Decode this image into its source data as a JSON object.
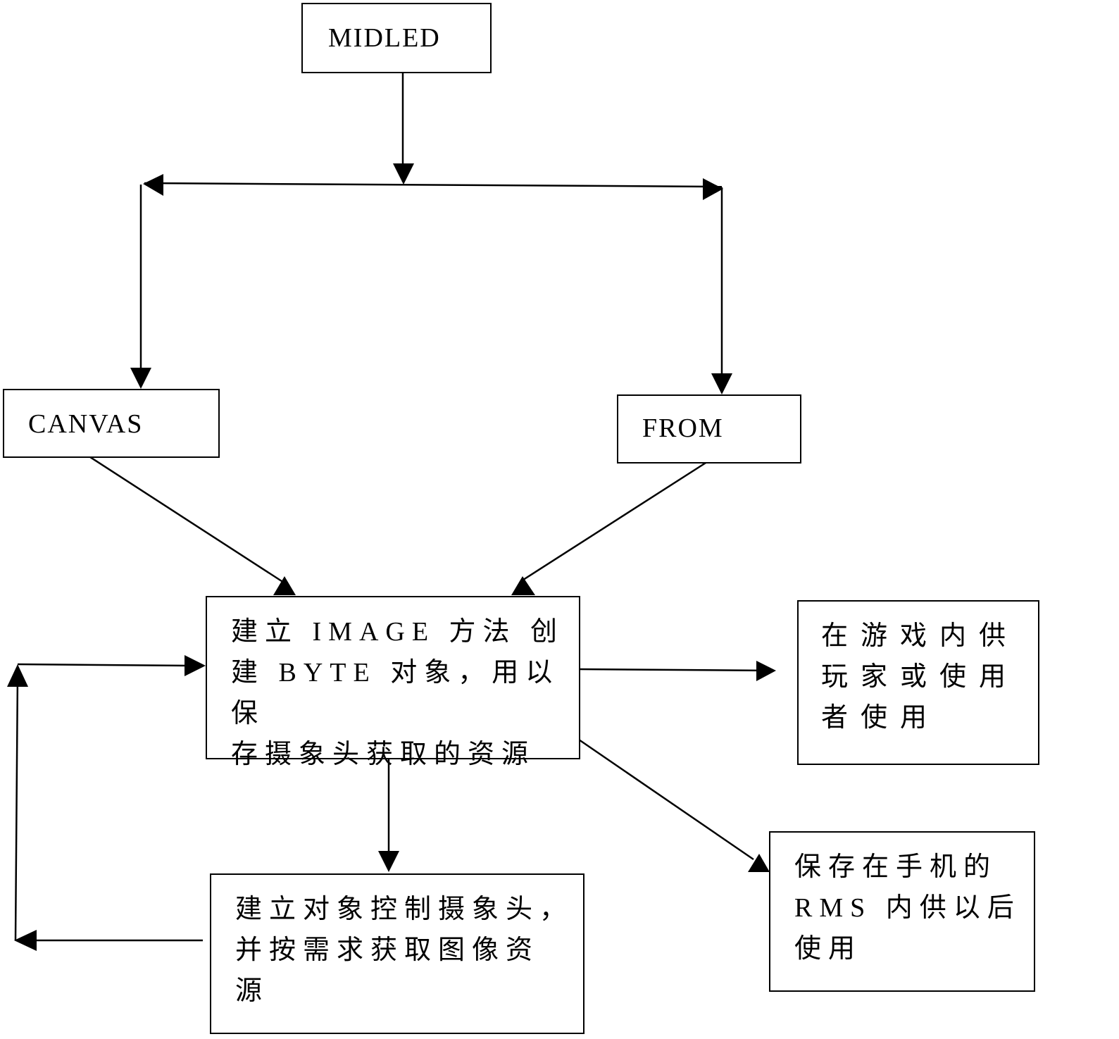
{
  "diagram": {
    "type": "flowchart",
    "nodes": {
      "midled": {
        "label": "MIDLED"
      },
      "canvas": {
        "label": "CANVAS"
      },
      "from": {
        "label": "FROM"
      },
      "image": {
        "label": "建立 IMAGE 方法 创\n建 BYTE 对象，用以保\n存摄象头获取的资源"
      },
      "game_use": {
        "label": "在游戏内供\n玩家或使用\n者使用"
      },
      "rms_save": {
        "label": "保存在手机的\nRMS 内供以后\n使用"
      },
      "camera_control": {
        "label": "建立对象控制摄象头，\n并按需求获取图像资\n源"
      }
    },
    "edges": [
      {
        "from": "midled",
        "to": "split"
      },
      {
        "from": "split",
        "to": "canvas"
      },
      {
        "from": "split",
        "to": "from"
      },
      {
        "from": "canvas",
        "to": "image"
      },
      {
        "from": "from",
        "to": "image"
      },
      {
        "from": "image",
        "to": "game_use"
      },
      {
        "from": "image",
        "to": "rms_save"
      },
      {
        "from": "image",
        "to": "camera_control"
      },
      {
        "from": "camera_control",
        "to": "image",
        "via": "left-loop"
      }
    ],
    "colors": {
      "line": "#000000",
      "background": "#ffffff"
    }
  }
}
